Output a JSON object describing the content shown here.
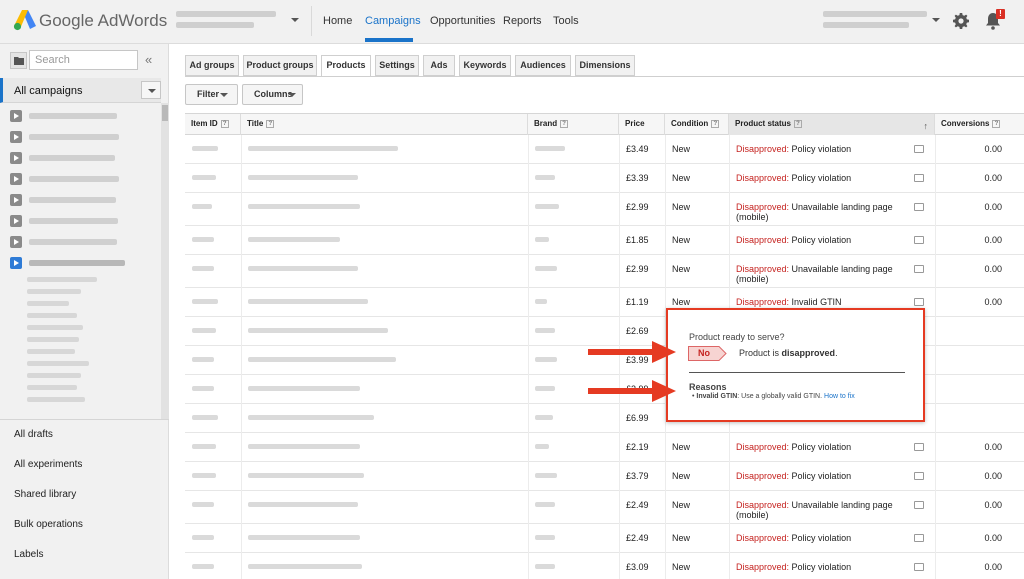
{
  "header": {
    "brand": "Google AdWords",
    "nav": [
      "Home",
      "Campaigns",
      "Opportunities",
      "Reports",
      "Tools"
    ],
    "active_nav": "Campaigns",
    "notification_badge": "!"
  },
  "sidebar": {
    "search_placeholder": "Search",
    "collapse_label": "«",
    "all_campaigns": "All campaigns",
    "links": [
      "All drafts",
      "All experiments",
      "Shared library",
      "Bulk operations",
      "Labels"
    ]
  },
  "tabs": [
    "Ad groups",
    "Product groups",
    "Products",
    "Settings",
    "Ads",
    "Keywords",
    "Audiences",
    "Dimensions"
  ],
  "active_tab": "Products",
  "toolbar": {
    "filter_label": "Filter",
    "columns_label": "Columns"
  },
  "table": {
    "headers": [
      "Item ID",
      "Title",
      "Brand",
      "Price",
      "Condition",
      "Product status",
      "Conversions"
    ],
    "help_mark": "?",
    "sort_indicator": "↑",
    "status_prefix": "Disapproved:",
    "rows": [
      {
        "price": "£3.49",
        "condition": "New",
        "status": "Policy violation",
        "conversions": "0.00"
      },
      {
        "price": "£3.39",
        "condition": "New",
        "status": "Policy violation",
        "conversions": "0.00"
      },
      {
        "price": "£2.99",
        "condition": "New",
        "status": "Unavailable landing page (mobile)",
        "conversions": "0.00"
      },
      {
        "price": "£1.85",
        "condition": "New",
        "status": "Policy violation",
        "conversions": "0.00"
      },
      {
        "price": "£2.99",
        "condition": "New",
        "status": "Unavailable landing page (mobile)",
        "conversions": "0.00"
      },
      {
        "price": "£1.19",
        "condition": "New",
        "status": "Invalid GTIN",
        "conversions": "0.00"
      },
      {
        "price": "£2.69",
        "condition": "",
        "status": "",
        "conversions": ""
      },
      {
        "price": "£3.99",
        "condition": "",
        "status": "",
        "conversions": ""
      },
      {
        "price": "£2.99",
        "condition": "",
        "status": "",
        "conversions": ""
      },
      {
        "price": "£6.99",
        "condition": "",
        "status": "",
        "conversions": ""
      },
      {
        "price": "£2.19",
        "condition": "New",
        "status": "Policy violation",
        "conversions": "0.00"
      },
      {
        "price": "£3.79",
        "condition": "New",
        "status": "Policy violation",
        "conversions": "0.00"
      },
      {
        "price": "£2.49",
        "condition": "New",
        "status": "Unavailable landing page (mobile)",
        "conversions": "0.00"
      },
      {
        "price": "£2.49",
        "condition": "New",
        "status": "Policy violation",
        "conversions": "0.00"
      },
      {
        "price": "£3.09",
        "condition": "New",
        "status": "Policy violation",
        "conversions": "0.00"
      }
    ]
  },
  "popup": {
    "question": "Product ready to serve?",
    "badge": "No",
    "message_prefix": "Product is",
    "message_bold": "disapproved",
    "message_suffix": ".",
    "reasons_title": "Reasons",
    "reason_label": "Invalid GTIN",
    "reason_text": ": Use a globally valid GTIN.",
    "reason_link": "How to fix"
  },
  "colors": {
    "accent": "#1a73c9",
    "error": "#c5221f",
    "highlight": "#e53a22"
  },
  "icons": [
    "adwords-logo-icon",
    "chevron-down-icon",
    "gear-icon",
    "bell-icon",
    "folder-icon",
    "campaign-icon",
    "help-icon",
    "comment-icon",
    "sort-up-icon",
    "arrow-right-icon"
  ]
}
